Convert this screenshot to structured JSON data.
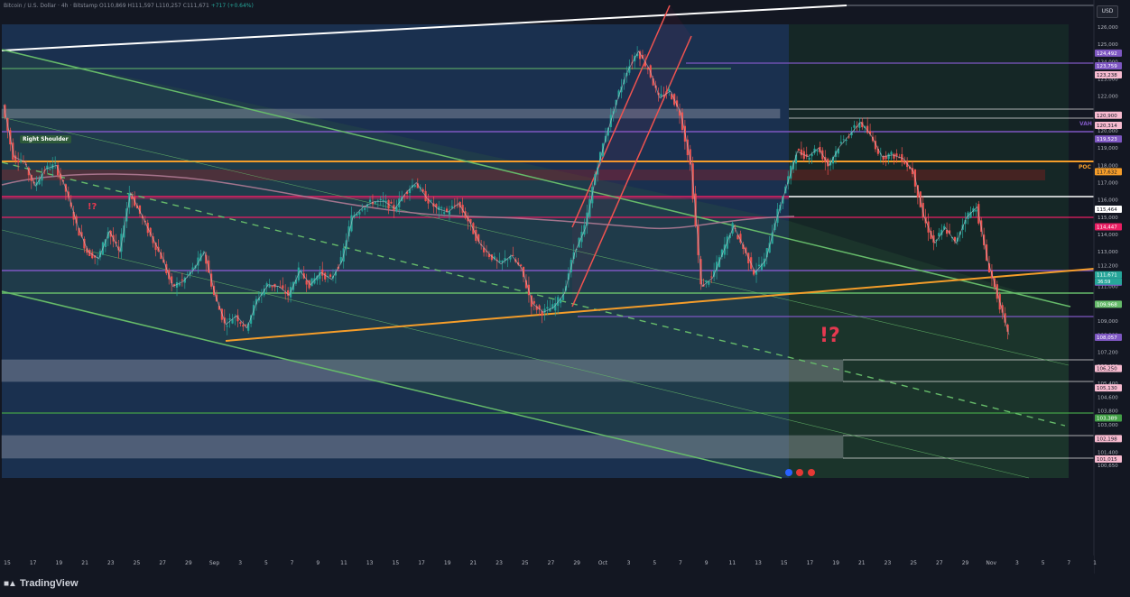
{
  "header": {
    "symbol_line": "Bitcoin / U.S. Dollar · 4h · Bitstamp",
    "ohlc": "O110,869 H111,597 L110,257 C111,671",
    "change": "+717 (+0.64%)"
  },
  "currency_button": "USD",
  "footer": {
    "brand": "TradingView"
  },
  "annotations": {
    "right_shoulder": "Right Shoulder",
    "question_small": "!?",
    "question_big": "!?",
    "poc": "POC",
    "vah": "VAH"
  },
  "chart_data": {
    "type": "candlestick",
    "title": "Bitcoin / U.S. Dollar · 4h · Bitstamp",
    "currency": "USD",
    "y_range": [
      100650,
      126000
    ],
    "x_tick_labels": [
      "15",
      "17",
      "19",
      "21",
      "23",
      "25",
      "27",
      "29",
      "Sep",
      "3",
      "5",
      "7",
      "9",
      "11",
      "13",
      "15",
      "17",
      "19",
      "21",
      "23",
      "25",
      "27",
      "29",
      "Oct",
      "3",
      "5",
      "7",
      "9",
      "11",
      "13",
      "15",
      "17",
      "19",
      "21",
      "23",
      "25",
      "27",
      "29",
      "Nov",
      "3",
      "5",
      "7",
      "1"
    ],
    "y_tick_labels": [
      "126,000",
      "125,000",
      "124,000",
      "123,000",
      "122,000",
      "121,000",
      "120,000",
      "119,000",
      "118,000",
      "117,000",
      "116,000",
      "115,000",
      "114,000",
      "113,000",
      "112,200",
      "111,000",
      "110,000",
      "109,000",
      "108,200",
      "107,200",
      "106,400",
      "105,400",
      "104,600",
      "103,800",
      "103,000",
      "102,200",
      "101,400",
      "100,650"
    ],
    "price_labels": [
      {
        "text": "124,492",
        "color": "#7e57c2"
      },
      {
        "text": "123,759",
        "color": "#7e57c2"
      },
      {
        "text": "123,238",
        "color": "#f8bbd0"
      },
      {
        "text": "120,900",
        "color": "#f8bbd0"
      },
      {
        "text": "120,314",
        "color": "#f8bbd0"
      },
      {
        "text": "119,523",
        "color": "#7e57c2"
      },
      {
        "text": "117,632",
        "color": "#f59d2a"
      },
      {
        "text": "115,464",
        "color": "#ffffff"
      },
      {
        "text": "114,447",
        "color": "#e91e63"
      },
      {
        "text": "111,671",
        "color": "#26a69a"
      },
      {
        "text": "111,245",
        "color": "#7e57c2"
      },
      {
        "text": "109,968",
        "color": "#66bb6a"
      },
      {
        "text": "108,057",
        "color": "#7e57c2"
      },
      {
        "text": "106,250",
        "color": "#f8bbd0"
      },
      {
        "text": "105,130",
        "color": "#f8bbd0"
      },
      {
        "text": "103,389",
        "color": "#43a047"
      },
      {
        "text": "102,198",
        "color": "#f8bbd0"
      },
      {
        "text": "101,015",
        "color": "#f8bbd0"
      }
    ],
    "countdown": "36:59",
    "horizontal_levels": [
      {
        "price": 124492,
        "color": "#7e57c2"
      },
      {
        "price": 123238,
        "color": "#66bb6a"
      },
      {
        "price": 120900,
        "color": "#e0e0e0"
      },
      {
        "price": 120314,
        "color": "#e0e0e0"
      },
      {
        "price": 119523,
        "color": "#7e57c2"
      },
      {
        "price": 117632,
        "color": "#f59d2a"
      },
      {
        "price": 115464,
        "color": "#ffffff"
      },
      {
        "price": 114447,
        "color": "#e91e63"
      },
      {
        "price": 111245,
        "color": "#7e57c2"
      },
      {
        "price": 109968,
        "color": "#66bb6a"
      },
      {
        "price": 108057,
        "color": "#7e57c2"
      },
      {
        "price": 106250,
        "color": "#e0e0e0"
      },
      {
        "price": 105130,
        "color": "#e0e0e0"
      },
      {
        "price": 103389,
        "color": "#43a047"
      },
      {
        "price": 102198,
        "color": "#e0e0e0"
      },
      {
        "price": 101015,
        "color": "#e0e0e0"
      }
    ],
    "price_path_points": [
      [
        121500,
        0
      ],
      [
        118500,
        2
      ],
      [
        118200,
        4
      ],
      [
        116800,
        6
      ],
      [
        117800,
        8
      ],
      [
        118000,
        10
      ],
      [
        116500,
        12
      ],
      [
        114500,
        14
      ],
      [
        113000,
        16
      ],
      [
        112600,
        18
      ],
      [
        114200,
        20
      ],
      [
        113000,
        22
      ],
      [
        116400,
        24
      ],
      [
        115200,
        26
      ],
      [
        113900,
        28
      ],
      [
        112700,
        30
      ],
      [
        111000,
        32
      ],
      [
        111300,
        34
      ],
      [
        112000,
        36
      ],
      [
        113000,
        38
      ],
      [
        110500,
        40
      ],
      [
        108800,
        42
      ],
      [
        109300,
        44
      ],
      [
        108600,
        46
      ],
      [
        110200,
        48
      ],
      [
        111100,
        50
      ],
      [
        111000,
        52
      ],
      [
        110500,
        54
      ],
      [
        111900,
        56
      ],
      [
        111100,
        58
      ],
      [
        111800,
        60
      ],
      [
        111400,
        62
      ],
      [
        112500,
        64
      ],
      [
        115000,
        66
      ],
      [
        115600,
        68
      ],
      [
        115900,
        70
      ],
      [
        115900,
        72
      ],
      [
        115500,
        74
      ],
      [
        116400,
        76
      ],
      [
        117000,
        78
      ],
      [
        116100,
        80
      ],
      [
        115500,
        82
      ],
      [
        115300,
        84
      ],
      [
        115800,
        86
      ],
      [
        114800,
        88
      ],
      [
        113500,
        90
      ],
      [
        112800,
        92
      ],
      [
        112300,
        94
      ],
      [
        112800,
        96
      ],
      [
        112000,
        98
      ],
      [
        110000,
        100
      ],
      [
        109500,
        102
      ],
      [
        109800,
        104
      ],
      [
        110600,
        106
      ],
      [
        113000,
        108
      ],
      [
        114400,
        110
      ],
      [
        117500,
        112
      ],
      [
        119800,
        114
      ],
      [
        121800,
        116
      ],
      [
        123500,
        118
      ],
      [
        124600,
        120
      ],
      [
        123600,
        122
      ],
      [
        121900,
        124
      ],
      [
        122300,
        126
      ],
      [
        121000,
        128
      ],
      [
        118000,
        130
      ],
      [
        111000,
        132
      ],
      [
        111500,
        134
      ],
      [
        113000,
        136
      ],
      [
        114500,
        138
      ],
      [
        113200,
        140
      ],
      [
        111800,
        142
      ],
      [
        112500,
        144
      ],
      [
        114800,
        146
      ],
      [
        116800,
        148
      ],
      [
        118800,
        150
      ],
      [
        118500,
        152
      ],
      [
        119000,
        154
      ],
      [
        118000,
        156
      ],
      [
        119100,
        158
      ],
      [
        119800,
        160
      ],
      [
        120500,
        162
      ],
      [
        119700,
        164
      ],
      [
        118500,
        166
      ],
      [
        118600,
        168
      ],
      [
        118400,
        170
      ],
      [
        117600,
        172
      ],
      [
        115000,
        174
      ],
      [
        113500,
        176
      ],
      [
        114400,
        178
      ],
      [
        113500,
        180
      ],
      [
        115000,
        182
      ],
      [
        115600,
        184
      ],
      [
        112500,
        186
      ],
      [
        110400,
        188
      ],
      [
        108200,
        190
      ]
    ],
    "moving_average_color": "#b07b95"
  }
}
